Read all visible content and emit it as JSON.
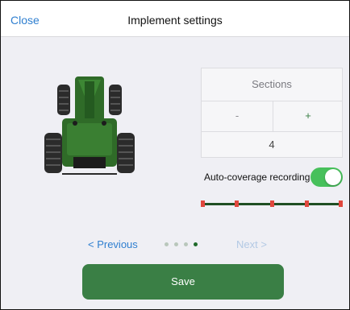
{
  "header": {
    "close_label": "Close",
    "title": "Implement settings"
  },
  "sections": {
    "title": "Sections",
    "minus_label": "-",
    "plus_label": "+",
    "value": "4"
  },
  "auto_coverage": {
    "label": "Auto-coverage recording",
    "enabled": true
  },
  "boom": {
    "segment_count": 4
  },
  "pager": {
    "previous_label": "< Previous",
    "next_label": "Next >",
    "page_count": 4,
    "current_page": 4
  },
  "save_label": "Save",
  "colors": {
    "accent_green": "#3a7f45",
    "toggle_green": "#47c05b",
    "link_blue": "#2f7fd0",
    "boom_red": "#e0473d"
  }
}
